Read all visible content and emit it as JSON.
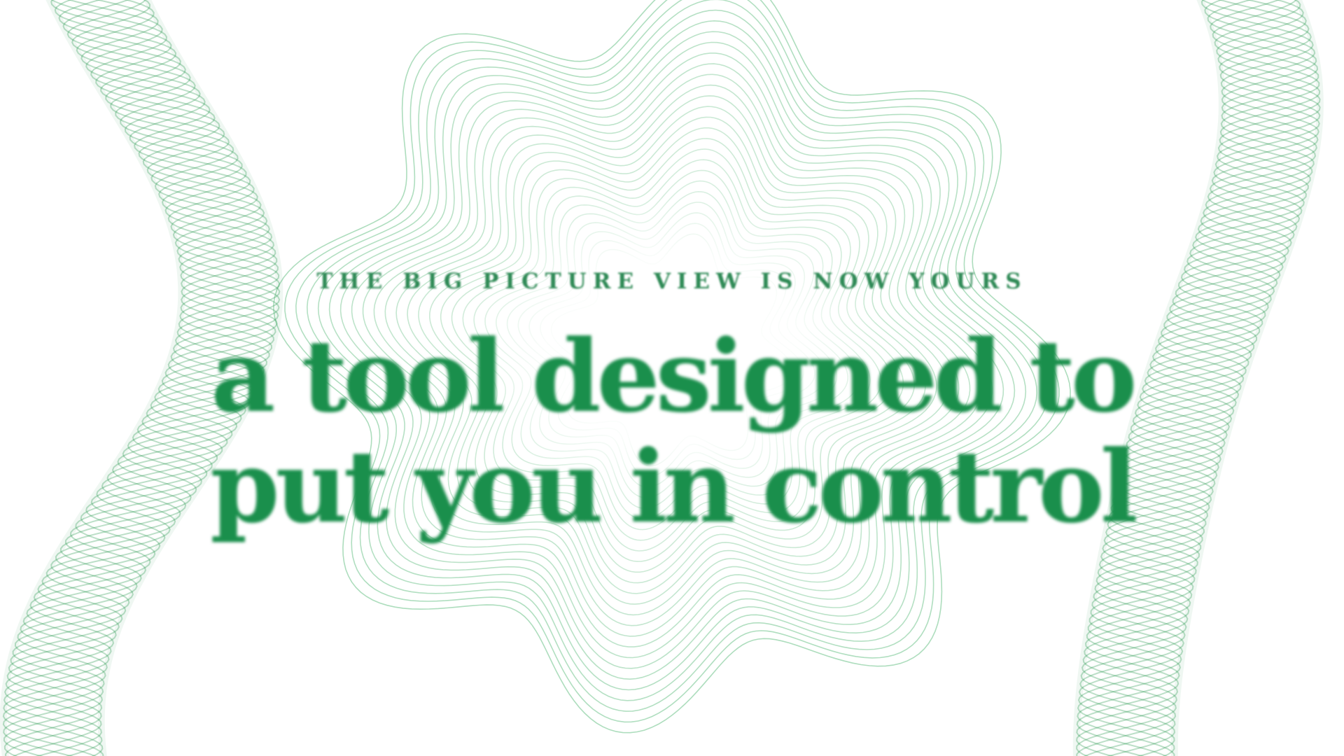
{
  "eyebrow": "THE BIG PICTURE VIEW IS NOW YOURS",
  "headline": {
    "line1": "a tool designed to",
    "line2": "put you in control"
  },
  "colors": {
    "text": "#1a8f4c",
    "eyebrow": "#2f8a56",
    "ribbon": "#2e9a55",
    "rosette": "#5cbb7c",
    "background": "#ffffff"
  },
  "decorations": {
    "rosette": "wavy-guilloche-rosette",
    "left_ribbon": "twisted-helix-ribbon",
    "right_ribbon": "twisted-helix-ribbon"
  }
}
